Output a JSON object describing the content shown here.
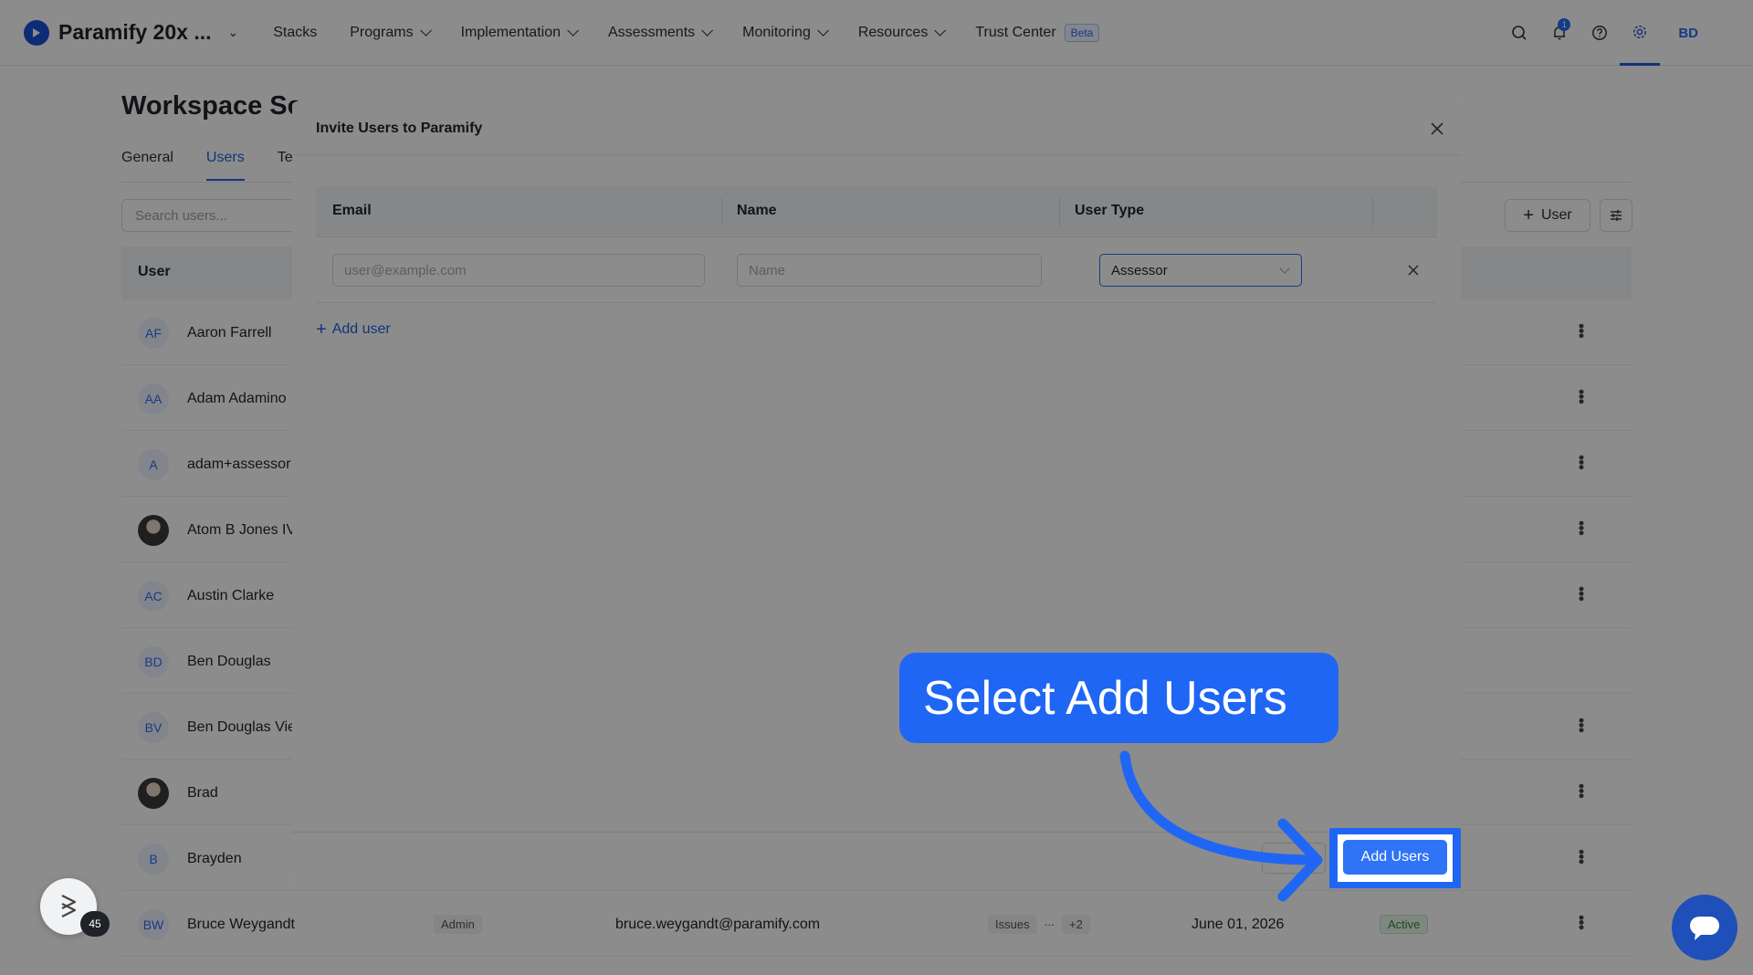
{
  "app": {
    "workspace_name": "Paramify 20x ...",
    "nav": [
      "Stacks",
      "Programs",
      "Implementation",
      "Assessments",
      "Monitoring",
      "Resources",
      "Trust Center"
    ],
    "beta_label": "Beta",
    "notification_count": "1",
    "user_initials": "BD"
  },
  "page": {
    "title": "Workspace Se",
    "tabs": [
      "General",
      "Users",
      "Te"
    ],
    "search_placeholder": "Search users...",
    "add_user_label": "User",
    "table_header_user": "User",
    "rows": [
      {
        "initials": "AF",
        "name": "Aaron Farrell",
        "photo": false
      },
      {
        "initials": "AA",
        "name": "Adam Adamino",
        "photo": false
      },
      {
        "initials": "A",
        "name": "adam+assessor",
        "photo": false
      },
      {
        "initials": "",
        "name": "Atom B Jones IV",
        "photo": true
      },
      {
        "initials": "AC",
        "name": "Austin Clarke",
        "photo": false
      },
      {
        "initials": "BD",
        "name": "Ben Douglas",
        "photo": false
      },
      {
        "initials": "BV",
        "name": "Ben Douglas Vie",
        "photo": false
      },
      {
        "initials": "",
        "name": "Brad",
        "photo": true
      },
      {
        "initials": "B",
        "name": "Brayden",
        "photo": false
      },
      {
        "initials": "BW",
        "name": "Bruce Weygandt",
        "photo": false
      }
    ],
    "last_row": {
      "role": "Admin",
      "email": "bruce.weygandt@paramify.com",
      "issues": "Issues",
      "more": "...",
      "plus": "+2",
      "date": "June 01, 2026",
      "status": "Active"
    }
  },
  "modal": {
    "title": "Invite Users to Paramify",
    "col_email": "Email",
    "col_name": "Name",
    "col_user_type": "User Type",
    "email_placeholder": "user@example.com",
    "name_placeholder": "Name",
    "user_type_value": "Assessor",
    "add_user_link": "Add user",
    "submit_label": "Add Users"
  },
  "callout": {
    "text": "Select Add Users"
  },
  "widgets": {
    "help_count": "45"
  },
  "colors": {
    "accent": "#1f66f4",
    "brand": "#1b4fd8"
  }
}
